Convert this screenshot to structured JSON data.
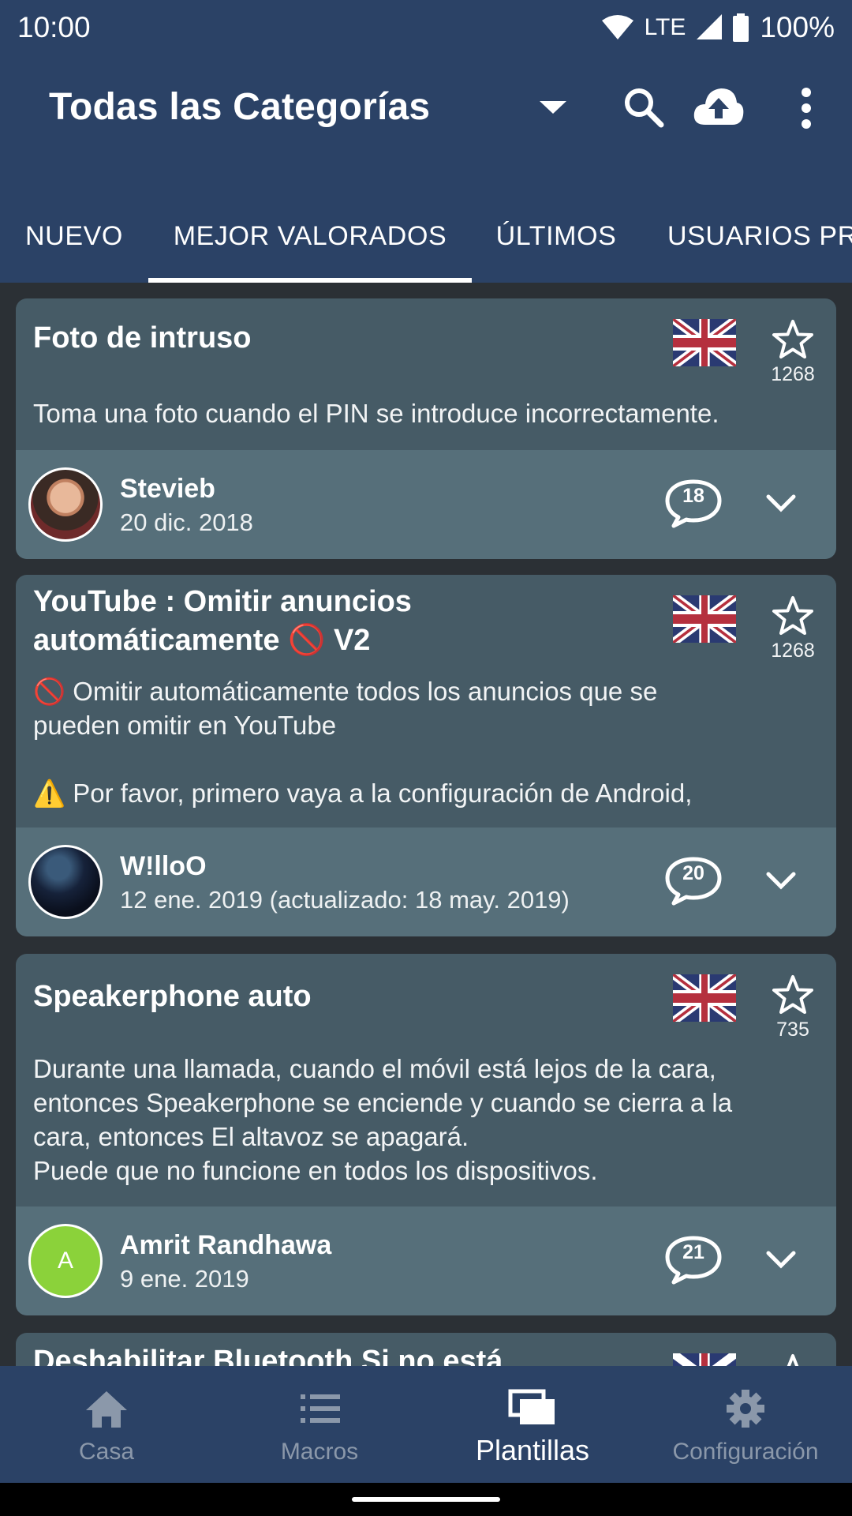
{
  "status_bar": {
    "time": "10:00",
    "network": "LTE",
    "battery": "100%"
  },
  "app_bar": {
    "title": "Todas las Categorías"
  },
  "tabs": [
    {
      "label": "NUEVO",
      "selected": false
    },
    {
      "label": "MEJOR VALORADOS",
      "selected": true
    },
    {
      "label": "ÚLTIMOS",
      "selected": false
    },
    {
      "label": "USUARIOS PR",
      "selected": false
    }
  ],
  "cards": [
    {
      "title": "Foto de intruso",
      "description": "Toma una foto cuando el PIN se introduce incorrectamente.",
      "rating": "1268",
      "author": "Stevieb",
      "date": "20 dic. 2018",
      "comments": "18"
    },
    {
      "title_line1": "YouTube : Omitir anuncios",
      "title_line2": "automáticamente 🚫 V2",
      "desc_line1": "🚫 Omitir automáticamente todos los anuncios que se",
      "desc_line2": "pueden omitir en YouTube",
      "desc_line3": "⚠️ Por favor, primero vaya a la configuración de Android,",
      "rating": "1268",
      "author": "W!lloO",
      "date": "12 ene. 2019 (actualizado: 18 may. 2019)",
      "comments": "20"
    },
    {
      "title": "Speakerphone auto",
      "desc_line1": "Durante una llamada, cuando el móvil está lejos de la cara,",
      "desc_line2": "entonces Speakerphone se enciende y cuando se cierra a la",
      "desc_line3": "cara, entonces El altavoz se apagará.",
      "desc_line4": "Puede que no funcione en todos los dispositivos.",
      "rating": "735",
      "author": "Amrit Randhawa",
      "avatar_letter": "A",
      "date": "9 ene. 2019",
      "comments": "21"
    },
    {
      "title": "Deshabilitar Bluetooth Si no está"
    }
  ],
  "bottom_nav": [
    {
      "label": "Casa",
      "icon": "home-icon",
      "active": false
    },
    {
      "label": "Macros",
      "icon": "list-icon",
      "active": false
    },
    {
      "label": "Plantillas",
      "icon": "templates-icon",
      "active": true
    },
    {
      "label": "Configuración",
      "icon": "gear-icon",
      "active": false
    }
  ],
  "colors": {
    "primary": "#2b4266",
    "card": "#465b66",
    "card_footer": "#566f7a",
    "background": "#2b3035",
    "inactive_nav": "#8b98aa",
    "avatar_green": "#8bd23a"
  }
}
